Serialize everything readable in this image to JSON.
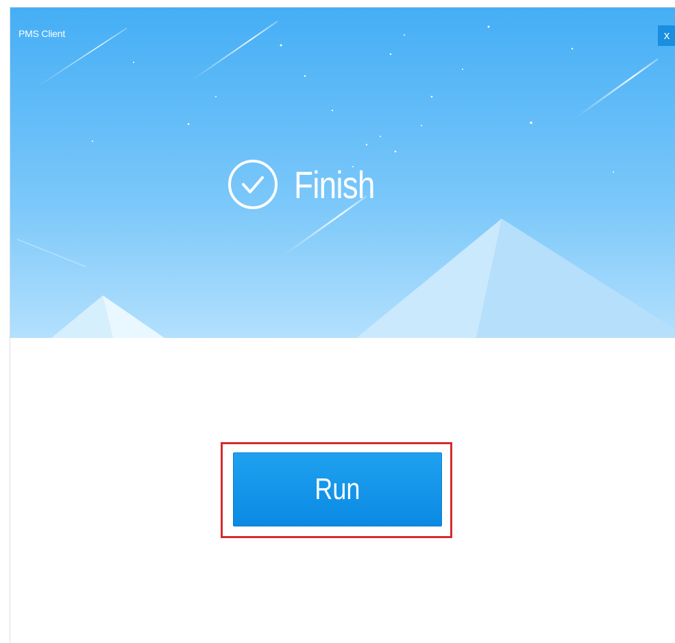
{
  "window": {
    "title": "PMS Client",
    "close_label": "x"
  },
  "banner": {
    "status_icon": "check-circle-icon",
    "status_label": "Finish",
    "colors": {
      "sky_top": "#48b0f5",
      "sky_bottom": "#a8dafc",
      "mountain": "#d4eefd"
    }
  },
  "actions": {
    "run_label": "Run",
    "run_color": "#1296ea",
    "highlight_color": "#d52b2b"
  }
}
